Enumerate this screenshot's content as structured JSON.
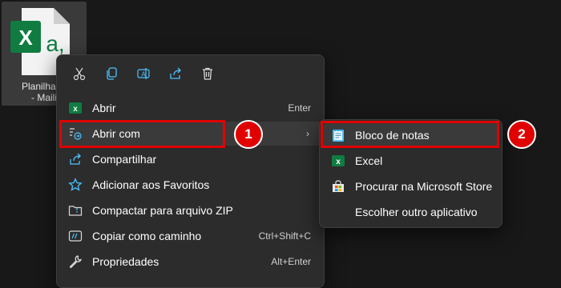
{
  "desktop_file": {
    "name_line1": "Planilha m",
    "name_line2": "- Maili"
  },
  "context_menu": {
    "toolbar": [
      {
        "name": "cut-icon"
      },
      {
        "name": "copy-icon"
      },
      {
        "name": "rename-icon"
      },
      {
        "name": "share-icon"
      },
      {
        "name": "delete-icon"
      }
    ],
    "items": [
      {
        "label": "Abrir",
        "shortcut": "Enter",
        "icon": "excel-icon"
      },
      {
        "label": "Abrir com",
        "shortcut": "",
        "icon": "open-with-icon",
        "submenu_arrow": "›"
      },
      {
        "label": "Compartilhar",
        "shortcut": "",
        "icon": "share-icon"
      },
      {
        "label": "Adicionar aos Favoritos",
        "shortcut": "",
        "icon": "star-icon"
      },
      {
        "label": "Compactar para arquivo ZIP",
        "shortcut": "",
        "icon": "zip-folder-icon"
      },
      {
        "label": "Copiar como caminho",
        "shortcut": "Ctrl+Shift+C",
        "icon": "copy-path-icon"
      },
      {
        "label": "Propriedades",
        "shortcut": "Alt+Enter",
        "icon": "wrench-icon"
      }
    ]
  },
  "submenu": {
    "items": [
      {
        "label": "Bloco de notas",
        "icon": "notepad-icon"
      },
      {
        "label": "Excel",
        "icon": "excel-icon"
      },
      {
        "label": "Procurar na Microsoft Store",
        "icon": "store-icon"
      },
      {
        "label": "Escolher outro aplicativo",
        "icon": ""
      }
    ]
  },
  "annotations": {
    "step1": "1",
    "step2": "2"
  },
  "colors": {
    "highlight": "#e00000",
    "excel_green": "#107c41",
    "accent_blue": "#4cc2ff"
  }
}
